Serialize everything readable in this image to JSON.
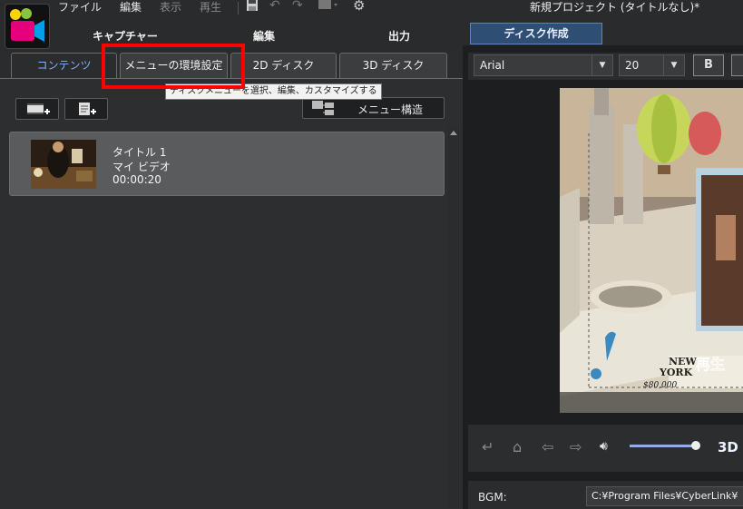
{
  "menubar": {
    "file": "ファイル",
    "edit": "編集",
    "view": "表示",
    "play": "再生"
  },
  "window_title": "新規プロジェクト (タイトルなし)*",
  "modes": {
    "capture": "キャプチャー",
    "edit": "編集",
    "output": "出力",
    "disc": "ディスク作成"
  },
  "tabs": {
    "contents": "コンテンツ",
    "menu_settings": "メニューの環境設定",
    "disc_2d": "2D ディスク",
    "disc_3d": "3D ディスク"
  },
  "tooltip": "ディスクメニューを選択、編集、カスタマイズする",
  "toolbar": {
    "menu_structure": "メニュー構造"
  },
  "titles": [
    {
      "name": "タイトル 1",
      "chapter": "マイ ビデオ",
      "duration": "00:00:20"
    }
  ],
  "font_panel": {
    "font": "Arial",
    "size": "20",
    "bold": "B"
  },
  "preview": {
    "play_label": "再生",
    "board_text_1": "NEW",
    "board_text_2": "YORK",
    "board_price": "$80,000"
  },
  "playback": {
    "mode_3d": "3D"
  },
  "bgm": {
    "label": "BGM:",
    "value": "C:¥Program Files¥CyberLink¥"
  },
  "colors": {
    "accent": "#7fb2ff",
    "highlight_box": "#ff0000",
    "active_mode": "#2e4e73"
  }
}
